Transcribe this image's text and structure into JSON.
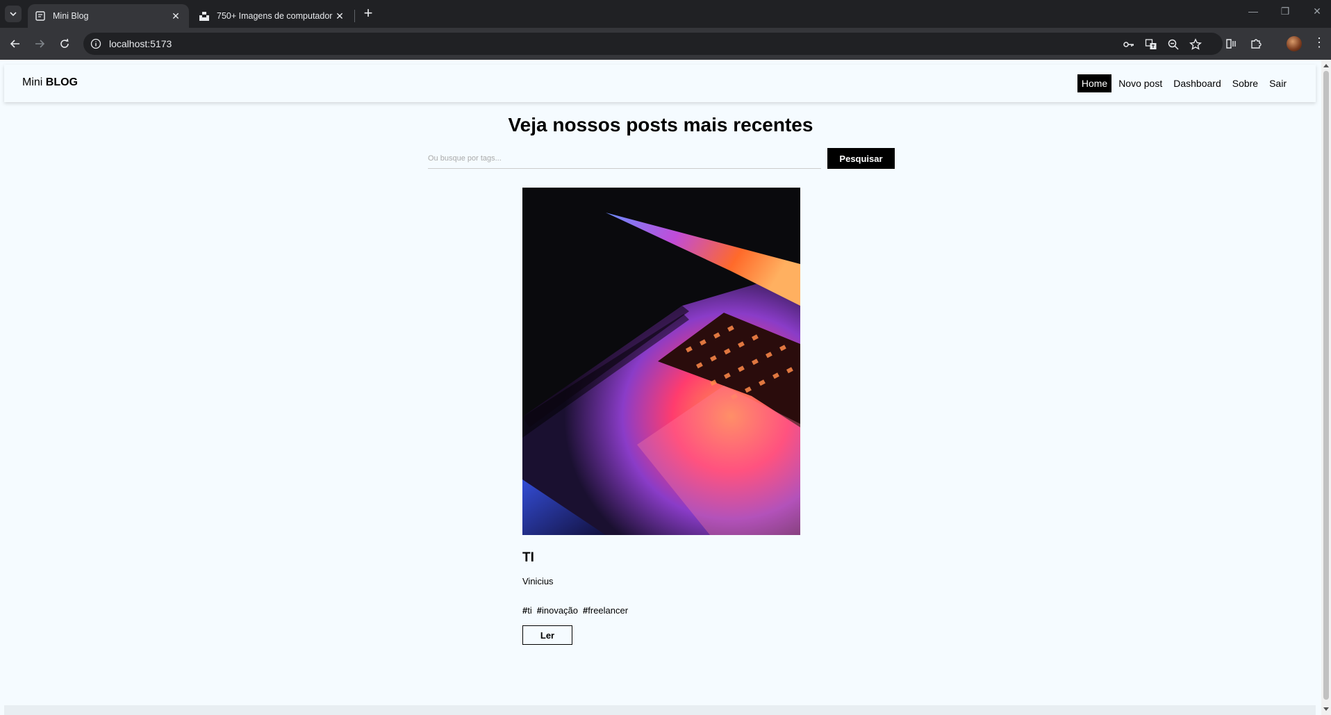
{
  "browser": {
    "tabs": [
      {
        "title": "Mini Blog",
        "active": true,
        "icon": "page-icon"
      },
      {
        "title": "750+ Imagens de computador | ",
        "active": false,
        "icon": "unsplash-icon"
      }
    ],
    "url": "localhost:5173"
  },
  "site": {
    "brand_prefix": "Mini ",
    "brand_strong": "BLOG",
    "nav": [
      {
        "label": "Home",
        "active": true
      },
      {
        "label": "Novo post",
        "active": false
      },
      {
        "label": "Dashboard",
        "active": false
      },
      {
        "label": "Sobre",
        "active": false
      },
      {
        "label": "Sair",
        "active": false
      }
    ]
  },
  "home": {
    "title": "Veja nossos posts mais recentes",
    "search_placeholder": "Ou busque por tags...",
    "search_button": "Pesquisar"
  },
  "post": {
    "title": "TI",
    "author": "Vinicius",
    "tags": [
      "ti",
      "inovação",
      "freelancer"
    ],
    "read_button": "Ler",
    "image_alt": "laptop keyboard with colorful light"
  },
  "colors": {
    "page_bg": "#f5fbff",
    "chrome_dark": "#202124",
    "chrome_toolbar": "#35363a",
    "accent": "#000000"
  }
}
